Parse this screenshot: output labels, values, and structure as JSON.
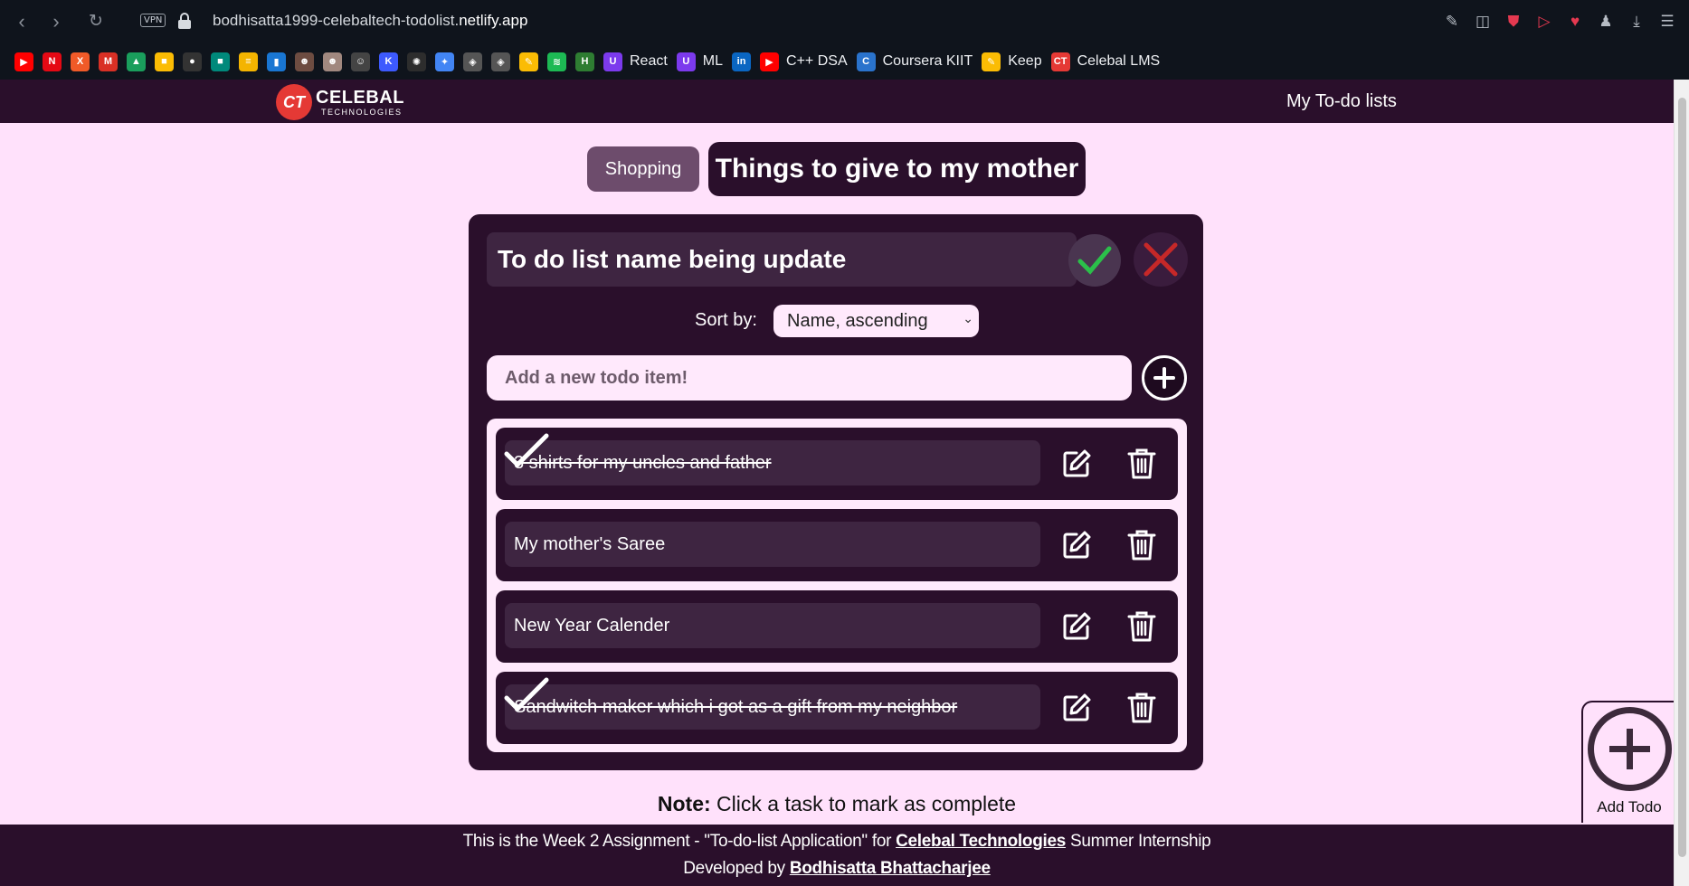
{
  "browser": {
    "url_prefix": "bodhisatta1999-celebaltech-todolist.",
    "url_domain": "netlify.app",
    "vpn_label": "VPN",
    "bookmarks": [
      {
        "label": "",
        "icon": "youtube-icon",
        "color": "#ff0000",
        "glyph": "▶"
      },
      {
        "label": "",
        "icon": "netflix-icon",
        "color": "#e50914",
        "glyph": "N"
      },
      {
        "label": "",
        "icon": "x-icon",
        "color": "#f05a28",
        "glyph": "X"
      },
      {
        "label": "",
        "icon": "gmail-icon",
        "color": "#d93025",
        "glyph": "M"
      },
      {
        "label": "",
        "icon": "drive-icon",
        "color": "#1a9e5c",
        "glyph": "▲"
      },
      {
        "label": "",
        "icon": "photos-icon",
        "color": "#fbbc04",
        "glyph": "■"
      },
      {
        "label": "",
        "icon": "github-icon",
        "color": "#333333",
        "glyph": "●"
      },
      {
        "label": "",
        "icon": "meet-icon",
        "color": "#00897b",
        "glyph": "■"
      },
      {
        "label": "",
        "icon": "bookmark-icon",
        "color": "#f4b400",
        "glyph": "≡"
      },
      {
        "label": "",
        "icon": "analytics-icon",
        "color": "#1976d2",
        "glyph": "▮"
      },
      {
        "label": "",
        "icon": "avatar-icon",
        "color": "#6d4c41",
        "glyph": "☻"
      },
      {
        "label": "",
        "icon": "avatar2-icon",
        "color": "#a1887f",
        "glyph": "☻"
      },
      {
        "label": "",
        "icon": "emoji-icon",
        "color": "#444444",
        "glyph": "☺"
      },
      {
        "label": "",
        "icon": "kite-icon",
        "color": "#3d5afe",
        "glyph": "K"
      },
      {
        "label": "",
        "icon": "chatgpt-icon",
        "color": "#2d2d2d",
        "glyph": "✺"
      },
      {
        "label": "",
        "icon": "gemini-icon",
        "color": "#4285f4",
        "glyph": "✦"
      },
      {
        "label": "",
        "icon": "unity-icon",
        "color": "#555555",
        "glyph": "◈"
      },
      {
        "label": "",
        "icon": "unity2-icon",
        "color": "#555555",
        "glyph": "◈"
      },
      {
        "label": "",
        "icon": "keep-note-icon",
        "color": "#fbbc04",
        "glyph": "✎"
      },
      {
        "label": "",
        "icon": "spotify-icon",
        "color": "#1db954",
        "glyph": "≋"
      },
      {
        "label": "",
        "icon": "hn-icon",
        "color": "#2e7d32",
        "glyph": "H"
      },
      {
        "label": "React",
        "icon": "react-icon",
        "color": "#7c3aed",
        "glyph": "U"
      },
      {
        "label": "ML",
        "icon": "ml-icon",
        "color": "#7c3aed",
        "glyph": "U"
      },
      {
        "label": "",
        "icon": "linkedin-icon",
        "color": "#0a66c2",
        "glyph": "in"
      },
      {
        "label": "C++ DSA",
        "icon": "youtube-icon",
        "color": "#ff0000",
        "glyph": "▶"
      },
      {
        "label": "Coursera KIIT",
        "icon": "coursera-icon",
        "color": "#2a73cc",
        "glyph": "C"
      },
      {
        "label": "Keep",
        "icon": "keep-icon",
        "color": "#fbbc04",
        "glyph": "✎"
      },
      {
        "label": "Celebal LMS",
        "icon": "celebal-icon",
        "color": "#e53935",
        "glyph": "CT"
      }
    ]
  },
  "header": {
    "logo_mark": "CT",
    "logo_main": "CELEBAL",
    "logo_sub": "TECHNOLOGIES",
    "nav_link": "My To-do lists"
  },
  "tabs": [
    {
      "label": "Shopping",
      "active": false
    },
    {
      "label": "Things to give to my mother",
      "active": true
    }
  ],
  "editor": {
    "list_name_value": "To do list name being update",
    "sort_label": "Sort by:",
    "sort_selected": "Name, ascending",
    "add_placeholder": "Add a new todo item!"
  },
  "items": [
    {
      "text": "3 shirts for my uncles and father",
      "done": true
    },
    {
      "text": "My mother's Saree",
      "done": false
    },
    {
      "text": "New Year Calender",
      "done": false
    },
    {
      "text": "Sandwitch maker which i got as a gift from my neighbor",
      "done": true
    }
  ],
  "note": {
    "bold": "Note:",
    "text": " Click a task to mark as complete"
  },
  "fab": {
    "label": "Add Todo"
  },
  "footer": {
    "line1_pre": "This is the Week 2 Assignment - \"To-do-list Application\" for ",
    "line1_link": "Celebal Technologies",
    "line1_post": " Summer Internship",
    "line2_pre": "Developed by ",
    "line2_link": "Bodhisatta Bhattacharjee"
  },
  "colors": {
    "primary_dark": "#2a0f2b",
    "page_bg": "#ffe1fb",
    "input_bg": "#3e2541",
    "confirm_green": "#2bbf4a",
    "cancel_red": "#c62828"
  }
}
